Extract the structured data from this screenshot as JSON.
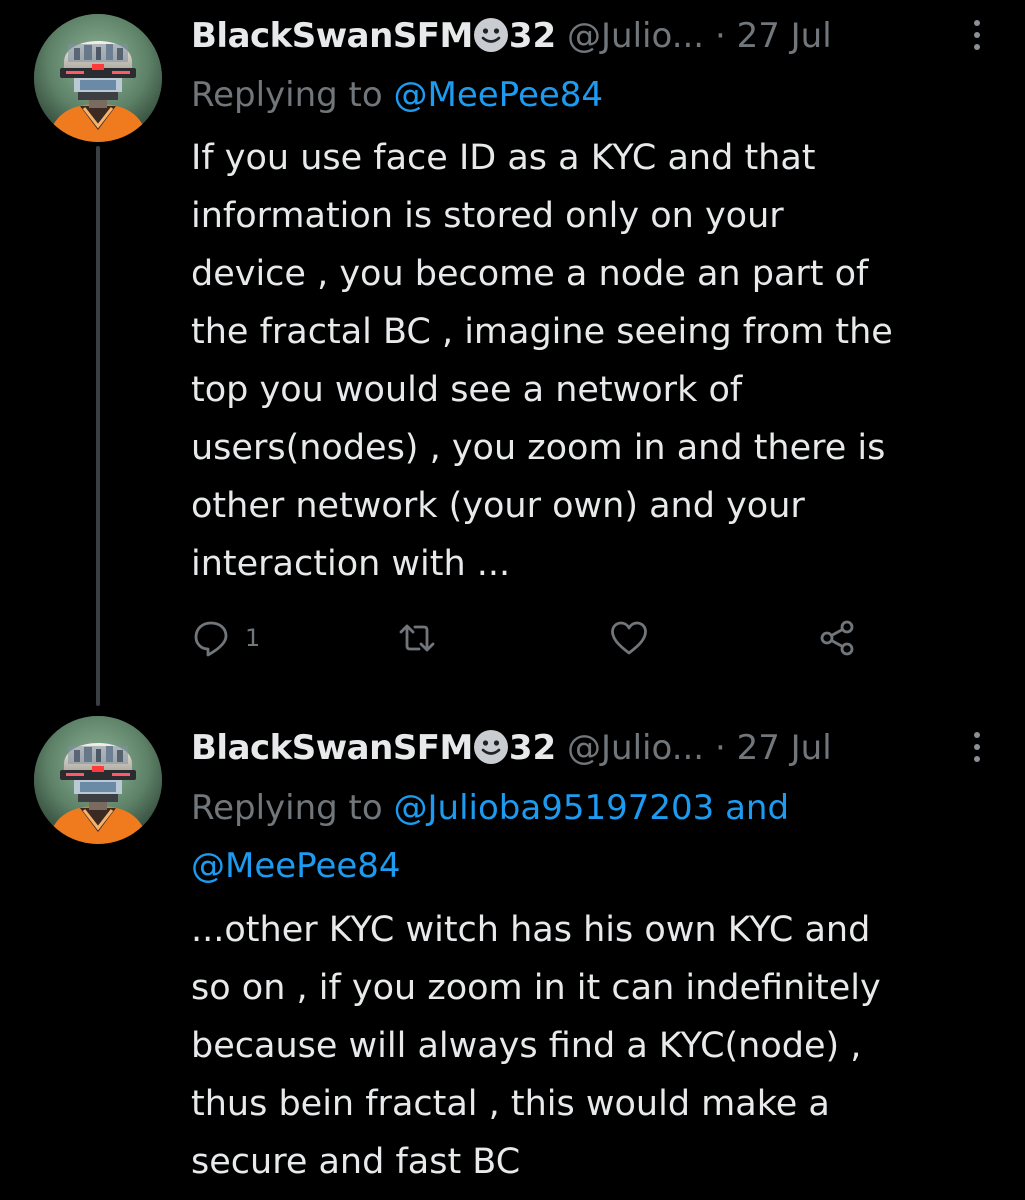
{
  "tweets": [
    {
      "display_name": "BlackSwanSFM",
      "name_emoji": "slightly-smiling-face-emoji",
      "name_suffix": "32",
      "handle": "@Julio...",
      "date_separator": "·",
      "date": "27 Jul",
      "replying_prefix": "Replying to",
      "replying_mentions": [
        "@MeePee84"
      ],
      "replying_joiner": "",
      "body_lines": [
        "If you use face ID as a KYC and that",
        "information is stored only on your",
        "device , you become a node an part of",
        "the fractal BC , imagine seeing from the",
        "top you would see a network of",
        "users(nodes) , you zoom in and there is",
        "other network (your own) and your",
        "interaction with ..."
      ],
      "actions": {
        "reply_icon": "reply-icon",
        "reply_count": "1",
        "retweet_icon": "retweet-icon",
        "like_icon": "heart-icon",
        "share_icon": "share-icon"
      }
    },
    {
      "display_name": "BlackSwanSFM",
      "name_emoji": "slightly-smiling-face-emoji",
      "name_suffix": "32",
      "handle": "@Julio...",
      "date_separator": "·",
      "date": "27 Jul",
      "replying_prefix": "Replying to",
      "replying_mentions": [
        "@Julioba95197203",
        "@MeePee84"
      ],
      "replying_joiner": "and",
      "body_lines": [
        "...other KYC witch has his own KYC and",
        "so on , if you zoom in it can indefinitely",
        "because will always find a KYC(node) ,",
        "thus bein fractal , this would make a",
        "secure and fast BC"
      ]
    }
  ],
  "colors": {
    "background": "#000000",
    "text_primary": "#e7e9ea",
    "text_secondary": "#71767b",
    "link": "#1d9bf0",
    "thread_line": "#3a3f44"
  }
}
